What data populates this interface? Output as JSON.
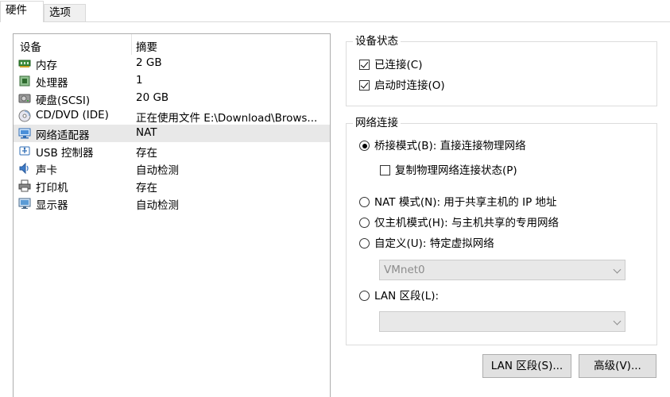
{
  "tabs": [
    {
      "label": "硬件",
      "active": true
    },
    {
      "label": "选项",
      "active": false
    }
  ],
  "device_list": {
    "columns": [
      "设备",
      "摘要"
    ],
    "rows": [
      {
        "icon": "memory-icon",
        "name": "内存",
        "summary": "2 GB",
        "selected": false
      },
      {
        "icon": "processor-icon",
        "name": "处理器",
        "summary": "1",
        "selected": false
      },
      {
        "icon": "hard-disk-icon",
        "name": "硬盘(SCSI)",
        "summary": "20 GB",
        "selected": false
      },
      {
        "icon": "cd-dvd-icon",
        "name": "CD/DVD (IDE)",
        "summary": "正在使用文件 E:\\Download\\Brows...",
        "selected": false
      },
      {
        "icon": "network-adapter-icon",
        "name": "网络适配器",
        "summary": "NAT",
        "selected": true
      },
      {
        "icon": "usb-controller-icon",
        "name": "USB 控制器",
        "summary": "存在",
        "selected": false
      },
      {
        "icon": "sound-card-icon",
        "name": "声卡",
        "summary": "自动检测",
        "selected": false
      },
      {
        "icon": "printer-icon",
        "name": "打印机",
        "summary": "存在",
        "selected": false
      },
      {
        "icon": "display-icon",
        "name": "显示器",
        "summary": "自动检测",
        "selected": false
      }
    ]
  },
  "device_status": {
    "title": "设备状态",
    "connected": {
      "label": "已连接(C)",
      "checked": true
    },
    "connect_at_power_on": {
      "label": "启动时连接(O)",
      "checked": true
    }
  },
  "network_connection": {
    "title": "网络连接",
    "bridged": {
      "label": "桥接模式(B): 直接连接物理网络",
      "selected": true
    },
    "replicate_state": {
      "label": "复制物理网络连接状态(P)",
      "checked": false
    },
    "nat": {
      "label": "NAT 模式(N): 用于共享主机的 IP 地址",
      "selected": false
    },
    "host_only": {
      "label": "仅主机模式(H): 与主机共享的专用网络",
      "selected": false
    },
    "custom": {
      "label": "自定义(U): 特定虚拟网络",
      "selected": false
    },
    "custom_dropdown_value": "VMnet0",
    "lan_segment": {
      "label": "LAN 区段(L):",
      "selected": false
    },
    "lan_dropdown_value": ""
  },
  "buttons": {
    "lan_segments": "LAN 区段(S)...",
    "advanced": "高级(V)..."
  }
}
